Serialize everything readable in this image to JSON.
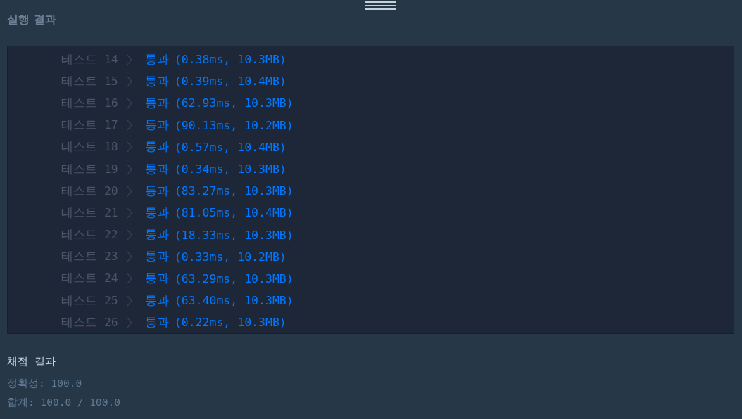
{
  "header": {
    "title": "실행 결과"
  },
  "tests": [
    {
      "label": "테스트 14",
      "status": "통과",
      "detail": "(0.38ms, 10.3MB)"
    },
    {
      "label": "테스트 15",
      "status": "통과",
      "detail": "(0.39ms, 10.4MB)"
    },
    {
      "label": "테스트 16",
      "status": "통과",
      "detail": "(62.93ms, 10.3MB)"
    },
    {
      "label": "테스트 17",
      "status": "통과",
      "detail": "(90.13ms, 10.2MB)"
    },
    {
      "label": "테스트 18",
      "status": "통과",
      "detail": "(0.57ms, 10.4MB)"
    },
    {
      "label": "테스트 19",
      "status": "통과",
      "detail": "(0.34ms, 10.3MB)"
    },
    {
      "label": "테스트 20",
      "status": "통과",
      "detail": "(83.27ms, 10.3MB)"
    },
    {
      "label": "테스트 21",
      "status": "통과",
      "detail": "(81.05ms, 10.4MB)"
    },
    {
      "label": "테스트 22",
      "status": "통과",
      "detail": "(18.33ms, 10.3MB)"
    },
    {
      "label": "테스트 23",
      "status": "통과",
      "detail": "(0.33ms, 10.2MB)"
    },
    {
      "label": "테스트 24",
      "status": "통과",
      "detail": "(63.29ms, 10.3MB)"
    },
    {
      "label": "테스트 25",
      "status": "통과",
      "detail": "(63.40ms, 10.3MB)"
    },
    {
      "label": "테스트 26",
      "status": "통과",
      "detail": "(0.22ms, 10.3MB)"
    }
  ],
  "grading": {
    "title": "채점 결과",
    "accuracy": "정확성: 100.0",
    "total": "합계: 100.0 / 100.0"
  }
}
